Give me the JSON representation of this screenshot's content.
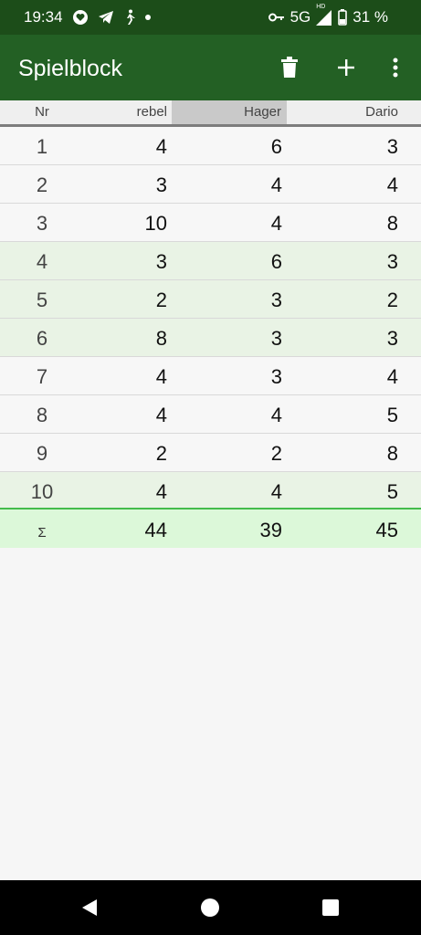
{
  "status": {
    "time": "19:34",
    "network": "5G",
    "network_badge": "HD",
    "battery": "31 %"
  },
  "appbar": {
    "title": "Spielblock",
    "actions": [
      "delete-icon",
      "add-icon",
      "more-vert-icon"
    ]
  },
  "table": {
    "headers": [
      "Nr",
      "rebel",
      "Hager",
      "Dario"
    ],
    "rows": [
      {
        "nr": "1",
        "v": [
          "4",
          "6",
          "3"
        ]
      },
      {
        "nr": "2",
        "v": [
          "3",
          "4",
          "4"
        ]
      },
      {
        "nr": "3",
        "v": [
          "10",
          "4",
          "8"
        ]
      },
      {
        "nr": "4",
        "v": [
          "3",
          "6",
          "3"
        ]
      },
      {
        "nr": "5",
        "v": [
          "2",
          "3",
          "2"
        ]
      },
      {
        "nr": "6",
        "v": [
          "8",
          "3",
          "3"
        ]
      },
      {
        "nr": "7",
        "v": [
          "4",
          "3",
          "4"
        ]
      },
      {
        "nr": "8",
        "v": [
          "4",
          "4",
          "5"
        ]
      },
      {
        "nr": "9",
        "v": [
          "2",
          "2",
          "8"
        ]
      },
      {
        "nr": "10",
        "v": [
          "4",
          "4",
          "5"
        ]
      }
    ],
    "sum": {
      "label": "Σ",
      "v": [
        "44",
        "39",
        "45"
      ]
    }
  },
  "colors": {
    "status_bar": "#1c4d19",
    "app_bar": "#236024",
    "row_highlight": "#e9f3e5",
    "sum_row": "#dcf8d9",
    "sum_border": "#43bb4b"
  },
  "nav": [
    "back-icon",
    "home-icon",
    "recents-icon"
  ]
}
